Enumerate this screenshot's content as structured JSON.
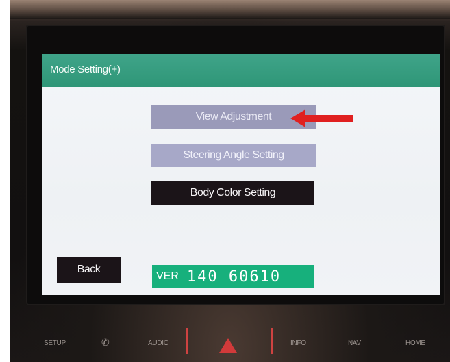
{
  "screen": {
    "title": "Mode Setting(+)",
    "menu": [
      {
        "label": "View Adjustment"
      },
      {
        "label": "Steering Angle Setting"
      },
      {
        "label": "Body Color Setting"
      }
    ],
    "back_label": "Back",
    "version": {
      "prefix": "VER",
      "number": "140 60610"
    }
  },
  "hardware_buttons": [
    {
      "label": "SETUP"
    },
    {
      "label": "AUDIO"
    },
    {
      "label": "INFO"
    },
    {
      "label": "NAV"
    },
    {
      "label": "HOME"
    }
  ],
  "colors": {
    "header": "#2f9677",
    "button_dark": "#1b1418",
    "button_light": "#9a9ab9",
    "version_bg": "#17b07c",
    "arrow": "#e02020"
  }
}
